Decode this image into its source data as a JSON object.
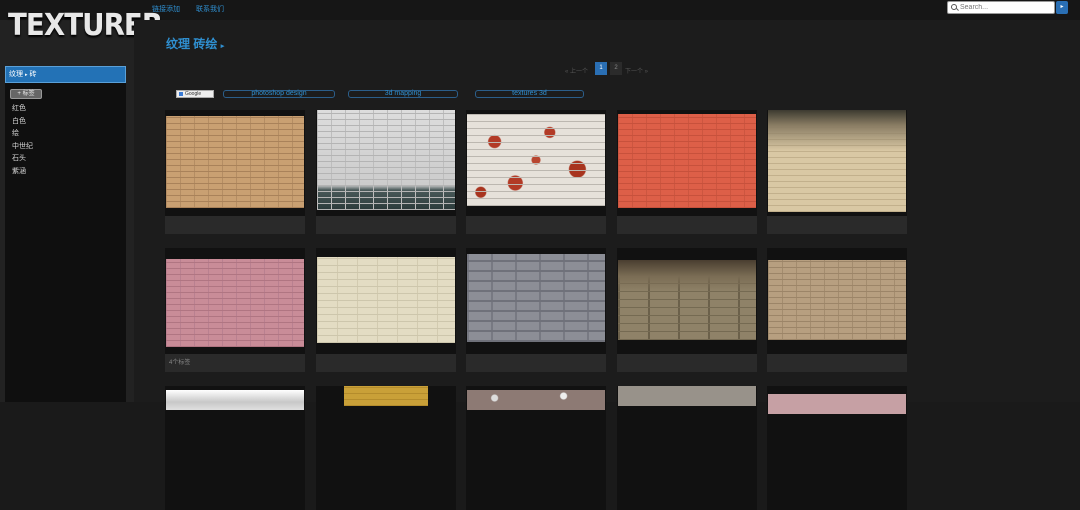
{
  "header": {
    "links": [
      "链接添加",
      "联系我们"
    ],
    "search": {
      "placeholder": "Search...",
      "button_glyph": "▸"
    }
  },
  "sidebar": {
    "logo": "TEXTURER",
    "breadcrumb": {
      "root": "纹理",
      "current": "砖",
      "sep": "▸"
    },
    "tag_button": "+ 标签",
    "categories": [
      "红色",
      "白色",
      "绘",
      "中世纪",
      "石头",
      "紫涵"
    ]
  },
  "main": {
    "title": "纹理 砖绘",
    "title_arrow": "▸",
    "pager": {
      "prev": "« 上一个",
      "pages": [
        "1",
        "2"
      ],
      "next": "下一个 »",
      "current": "1"
    },
    "google_badge": "Google",
    "tabs": [
      "photoshop design",
      "3d mapping",
      "textures 3d"
    ]
  },
  "tiles": [
    {
      "caption": ""
    },
    {
      "caption": ""
    },
    {
      "caption": ""
    },
    {
      "caption": ""
    },
    {
      "caption": ""
    },
    {
      "caption": ""
    },
    {
      "caption": ""
    },
    {
      "caption": ""
    },
    {
      "caption": ""
    },
    {
      "caption": ""
    },
    {
      "caption": "4个标签"
    },
    {
      "caption": ""
    },
    {
      "caption": ""
    },
    {
      "caption": ""
    },
    {
      "caption": ""
    }
  ],
  "colors": {
    "accent": "#2f8fd0",
    "active_bg": "#2372b6",
    "background": "#1c1c1c",
    "sidebar": "#222222"
  }
}
